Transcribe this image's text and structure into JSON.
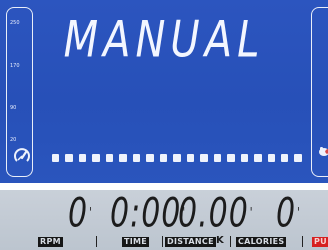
{
  "lcd": {
    "mode_title": "MANUAL",
    "scale_ticks": [
      "250",
      "170",
      "90",
      "20"
    ],
    "progress_segments": 19,
    "colors": {
      "lcd_background": "#2a52ba",
      "segment": "#eef2fc",
      "lower_background": "#c4ccd5"
    },
    "left_icon": "speed-dial-icon",
    "right_icon": "heart-hand-icon"
  },
  "readouts": {
    "rpm": {
      "value": "0",
      "label": "RPM"
    },
    "time": {
      "value": "0:00",
      "label": "TIME"
    },
    "distance": {
      "value": "0.00",
      "label": "DISTANCE",
      "unit": "K"
    },
    "calories": {
      "value": "0",
      "label": "CALORIES"
    },
    "pulse": {
      "label": "PU"
    }
  }
}
